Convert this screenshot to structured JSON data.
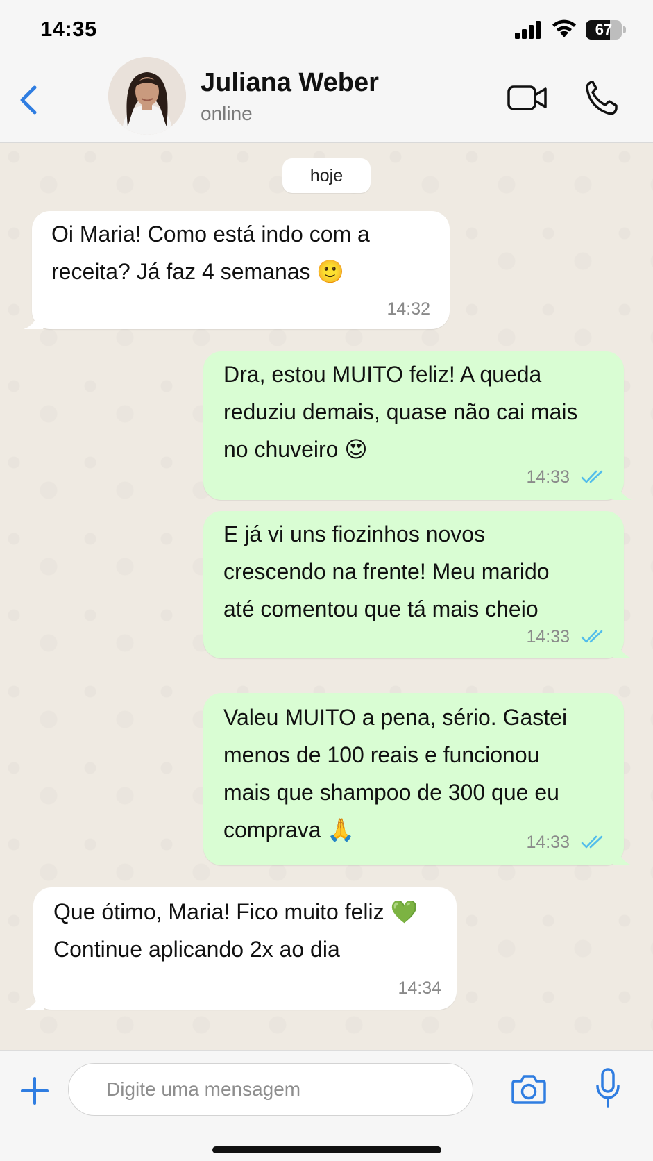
{
  "status_bar": {
    "time": "14:35",
    "battery_level": "67",
    "icons": [
      "signal-icon",
      "wifi-icon",
      "battery-icon"
    ]
  },
  "header": {
    "contact_name": "Juliana Weber",
    "contact_status": "online",
    "icons": [
      "back-arrow-icon",
      "video-camera-icon",
      "phone-icon"
    ],
    "accent_color": "#2f7de1"
  },
  "chat": {
    "date_label": "hoje",
    "messages": [
      {
        "direction": "in",
        "lines": [
          "Oi Maria! Como está indo com a",
          "receita? Já faz 4 semanas 🙂"
        ],
        "time": "14:32"
      },
      {
        "direction": "out",
        "lines": [
          "Dra, estou MUITO feliz! A queda",
          "reduziu demais, quase não cai mais",
          "no chuveiro 😍"
        ],
        "time": "14:33",
        "read": true
      },
      {
        "direction": "out",
        "lines": [
          "E já vi uns fiozinhos novos",
          "crescendo na frente! Meu marido",
          "até comentou que tá mais cheio"
        ],
        "time": "14:33",
        "read": true
      },
      {
        "direction": "out",
        "lines": [
          "Valeu MUITO a pena, sério. Gastei",
          "menos de 100 reais e funcionou",
          "mais que shampoo de 300 que eu",
          "comprava 🙏"
        ],
        "time": "14:33",
        "read": true
      },
      {
        "direction": "in",
        "lines": [
          "Que ótimo, Maria! Fico muito feliz 💚",
          "Continue aplicando 2x ao dia"
        ],
        "time": "14:34"
      }
    ],
    "colors": {
      "incoming": "#ffffff",
      "outgoing": "#d9fdd3",
      "read_ticks": "#53bdeb",
      "background": "#efeae2"
    }
  },
  "input_bar": {
    "placeholder": "Digite uma mensagem",
    "icons": [
      "plus-icon",
      "camera-icon",
      "microphone-icon"
    ]
  }
}
